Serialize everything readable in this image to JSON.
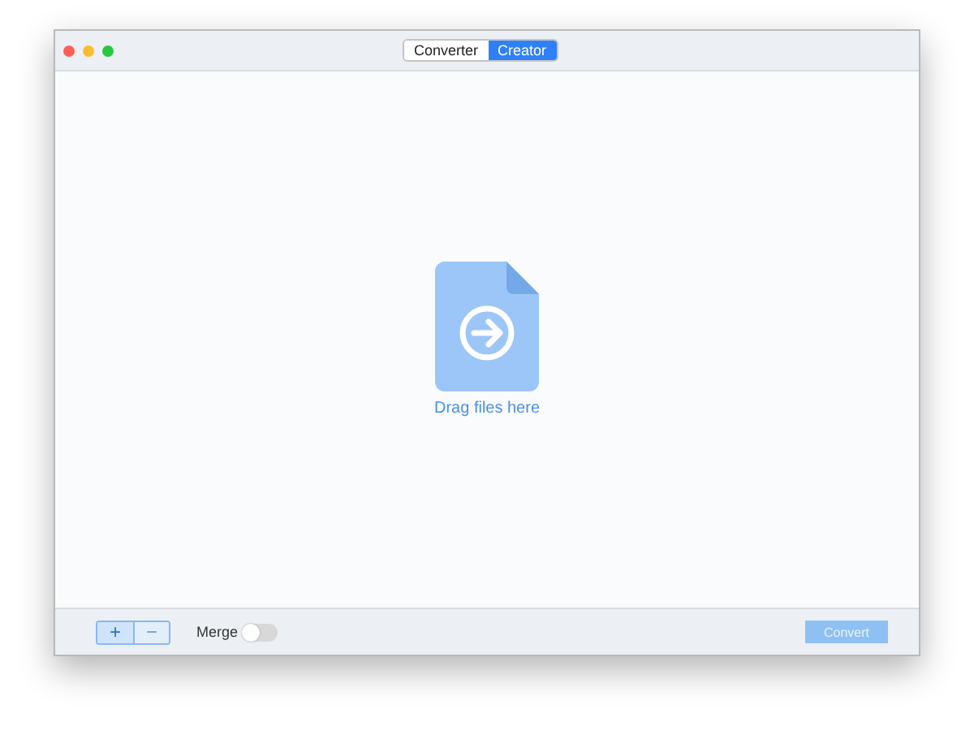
{
  "tabs": [
    {
      "label": "Converter",
      "selected": false
    },
    {
      "label": "Creator",
      "selected": true
    }
  ],
  "drop_zone": {
    "label": "Drag files here"
  },
  "footer": {
    "add_button": {
      "label": "+",
      "disabled": false
    },
    "remove_button": {
      "label": "−",
      "disabled": true
    },
    "merge": {
      "label": "Merge",
      "on": false
    },
    "convert_button": {
      "label": "Convert",
      "disabled": true
    }
  }
}
